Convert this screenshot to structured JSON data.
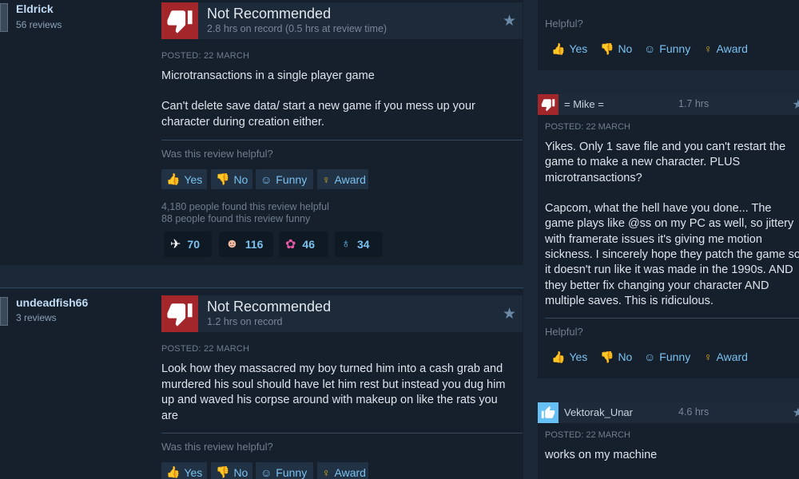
{
  "reviews": [
    {
      "author": "Eldrick",
      "author_reviews": "56 reviews",
      "verdict": "Not Recommended",
      "hours": "2.8 hrs on record (0.5 hrs at review time)",
      "posted": "POSTED: 22 MARCH",
      "body1": "Microtransactions in a single player game",
      "body2": "Can't delete save data/ start a new game if you mess up your character during creation either.",
      "helpful_question": "Was this review helpful?",
      "buttons": {
        "yes": "Yes",
        "no": "No",
        "funny": "Funny",
        "award": "Award"
      },
      "found_helpful": "4,180 people found this review helpful",
      "found_funny": "88 people found this review funny",
      "awards": [
        {
          "icon": "wings-award-icon",
          "count": "70"
        },
        {
          "icon": "face-award-icon",
          "count": "116"
        },
        {
          "icon": "candy-award-icon",
          "count": "46"
        },
        {
          "icon": "ribbon-award-icon",
          "count": "34"
        }
      ]
    },
    {
      "author": "undeadfish66",
      "author_reviews": "3 reviews",
      "verdict": "Not Recommended",
      "hours": "1.2 hrs on record",
      "posted": "POSTED: 22 MARCH",
      "body1": "Look how they massacred my boy turned him into a cash grab and murdered his soul should have let him rest but instead you dug him up and waved his corpse around with makeup on like the rats you are",
      "helpful_question": "Was this review helpful?",
      "buttons": {
        "yes": "Yes",
        "no": "No",
        "funny": "Funny",
        "award": "Award"
      }
    }
  ],
  "side_reviews": [
    {
      "helpful_question": "Helpful?",
      "buttons": {
        "yes": "Yes",
        "no": "No",
        "funny": "Funny",
        "award": "Award"
      }
    },
    {
      "name": "= Mike =",
      "hours": "1.7 hrs",
      "posted": "POSTED: 22 MARCH",
      "recommended": false,
      "text": "Yikes. Only 1 save file and you can't restart the game to make a new character. PLUS microtransactions?\n\nCapcom, what the hell have you done... The game plays like @ss on my PC as well, so jittery with framerate issues it's giving me motion sickness. I sincerely hope they patch the game so it doesn't run like it was made in the 1990s. AND they better fix changing your character AND multiple saves. This is ridiculous.",
      "helpful_question": "Helpful?",
      "buttons": {
        "yes": "Yes",
        "no": "No",
        "funny": "Funny",
        "award": "Award"
      }
    },
    {
      "name": "Vektorak_Unar",
      "hours": "4.6 hrs",
      "posted": "POSTED: 22 MARCH",
      "recommended": true,
      "text": "works on my machine"
    }
  ],
  "colors": {
    "background": "#1b2838",
    "not_recommended": "#a3262a",
    "recommended": "#66c0f4",
    "link": "#7ac1f0",
    "award_gold": "#e0b320"
  }
}
